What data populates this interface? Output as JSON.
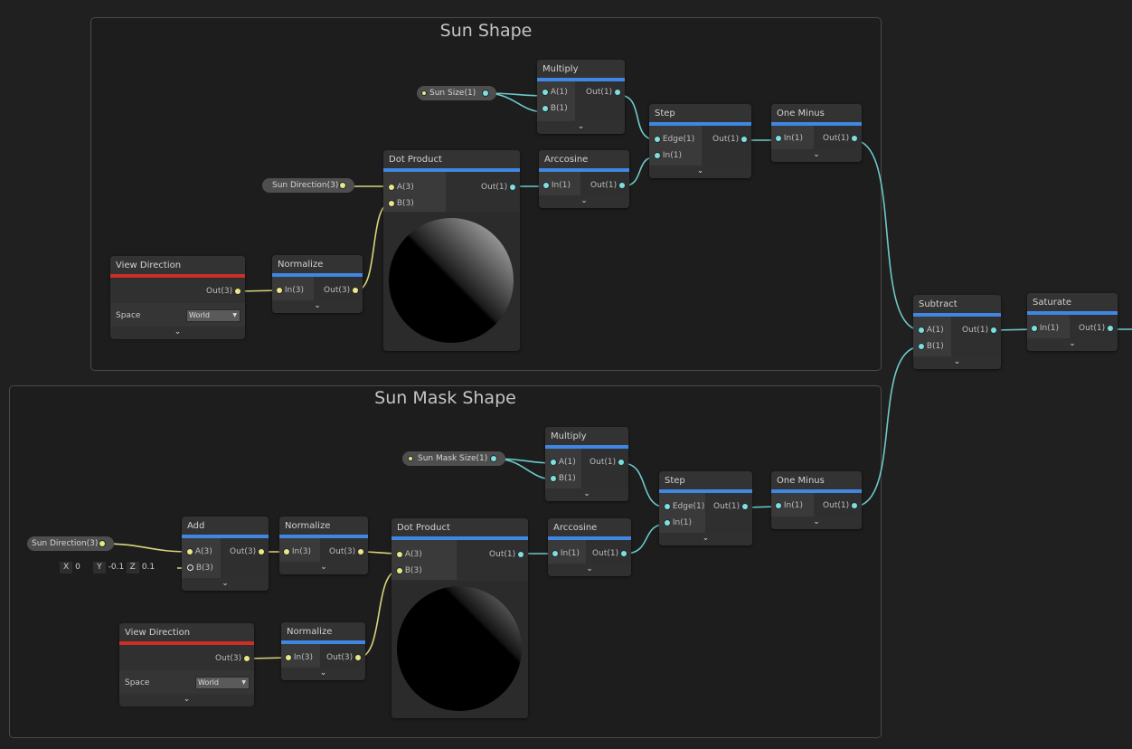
{
  "groups": {
    "sun_shape": {
      "title": "Sun Shape"
    },
    "sun_mask_shape": {
      "title": "Sun Mask Shape"
    }
  },
  "colors": {
    "header_bar": "#3f87e2",
    "view_direction_bar": "#cc2f25",
    "wire_float": "#6fc9c9",
    "wire_vector": "#d6d67a",
    "background": "#202020"
  },
  "footer_glyph": "⌄",
  "properties": {
    "sun_size": "Sun Size(1)",
    "sun_direction": "Sun Direction(3)",
    "sun_mask_size": "Sun Mask Size(1)"
  },
  "nodes": {
    "multiply_top": {
      "title": "Multiply",
      "in_a": "A(1)",
      "in_b": "B(1)",
      "out": "Out(1)"
    },
    "step_top": {
      "title": "Step",
      "in_edge": "Edge(1)",
      "in_in": "In(1)",
      "out": "Out(1)"
    },
    "one_minus_top": {
      "title": "One Minus",
      "in": "In(1)",
      "out": "Out(1)"
    },
    "dot_product_top": {
      "title": "Dot Product",
      "in_a": "A(3)",
      "in_b": "B(3)",
      "out": "Out(1)"
    },
    "arccosine_top": {
      "title": "Arccosine",
      "in": "In(1)",
      "out": "Out(1)"
    },
    "view_direction_top": {
      "title": "View Direction",
      "out": "Out(3)",
      "space_label": "Space",
      "space_value": "World"
    },
    "normalize_top": {
      "title": "Normalize",
      "in": "In(3)",
      "out": "Out(3)"
    },
    "subtract": {
      "title": "Subtract",
      "in_a": "A(1)",
      "in_b": "B(1)",
      "out": "Out(1)"
    },
    "saturate": {
      "title": "Saturate",
      "in": "In(1)",
      "out": "Out(1)"
    },
    "multiply_bottom": {
      "title": "Multiply",
      "in_a": "A(1)",
      "in_b": "B(1)",
      "out": "Out(1)"
    },
    "step_bottom": {
      "title": "Step",
      "in_edge": "Edge(1)",
      "in_in": "In(1)",
      "out": "Out(1)"
    },
    "one_minus_bottom": {
      "title": "One Minus",
      "in": "In(1)",
      "out": "Out(1)"
    },
    "add": {
      "title": "Add",
      "in_a": "A(3)",
      "in_b": "B(3)",
      "out": "Out(3)"
    },
    "normalize_bottom_a": {
      "title": "Normalize",
      "in": "In(3)",
      "out": "Out(3)"
    },
    "dot_product_bottom": {
      "title": "Dot Product",
      "in_a": "A(3)",
      "in_b": "B(3)",
      "out": "Out(1)"
    },
    "arccosine_bottom": {
      "title": "Arccosine",
      "in": "In(1)",
      "out": "Out(1)"
    },
    "view_direction_bottom": {
      "title": "View Direction",
      "out": "Out(3)",
      "space_label": "Space",
      "space_value": "World"
    },
    "normalize_bottom_b": {
      "title": "Normalize",
      "in": "In(3)",
      "out": "Out(3)"
    }
  },
  "add_b_default": {
    "x_label": "X",
    "x": "0",
    "y_label": "Y",
    "y": "-0.1",
    "z_label": "Z",
    "z": "0.1"
  }
}
